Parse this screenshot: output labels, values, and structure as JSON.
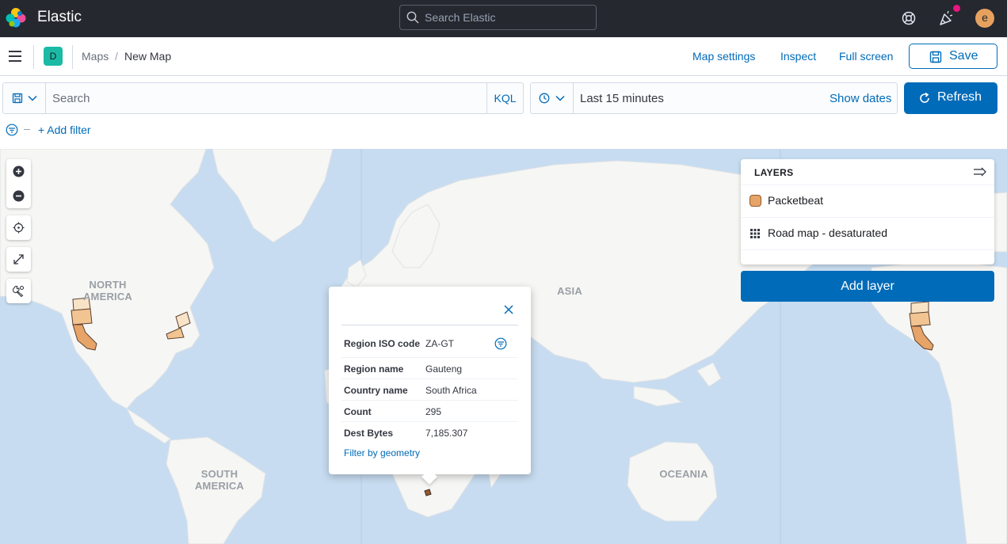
{
  "header": {
    "brand": "Elastic",
    "search_placeholder": "Search Elastic",
    "avatar_initial": "e",
    "icons": [
      "help-icon",
      "newsfeed-icon"
    ]
  },
  "breadcrumbs": {
    "space_initial": "D",
    "items": [
      "Maps",
      "New Map"
    ],
    "separator": "/"
  },
  "toolbar": {
    "map_settings": "Map settings",
    "inspect": "Inspect",
    "full_screen": "Full screen",
    "save": "Save"
  },
  "query": {
    "placeholder": "Search",
    "language": "KQL",
    "time_range": "Last 15 minutes",
    "show_dates": "Show dates",
    "refresh": "Refresh",
    "add_filter": "+ Add filter"
  },
  "map": {
    "labels": {
      "north_america": "NORTH\nAMERICA",
      "south_america": "SOUTH\nAMERICA",
      "asia": "ASIA",
      "oceania": "OCEANIA"
    },
    "controls": [
      "zoom-in",
      "zoom-out",
      "set-view",
      "fit-to-data",
      "tools"
    ],
    "colors": {
      "ocean": "#c7dcf0",
      "land": "#f6f6f4",
      "choropleth_light": "#f9e3c7",
      "choropleth_mid": "#f1c492",
      "choropleth_dark": "#e7a468"
    }
  },
  "layers": {
    "title": "LAYERS",
    "items": [
      {
        "name": "Packetbeat",
        "icon": "orange-swatch"
      },
      {
        "name": "Road map - desaturated",
        "icon": "grid-icon"
      }
    ],
    "add_layer": "Add layer"
  },
  "tooltip": {
    "rows": [
      {
        "key": "Region ISO code",
        "value": "ZA-GT"
      },
      {
        "key": "Region name",
        "value": "Gauteng"
      },
      {
        "key": "Country name",
        "value": "South Africa"
      },
      {
        "key": "Count",
        "value": "295"
      },
      {
        "key": "Dest Bytes",
        "value": "7,185.307"
      }
    ],
    "filter_link": "Filter by geometry"
  }
}
